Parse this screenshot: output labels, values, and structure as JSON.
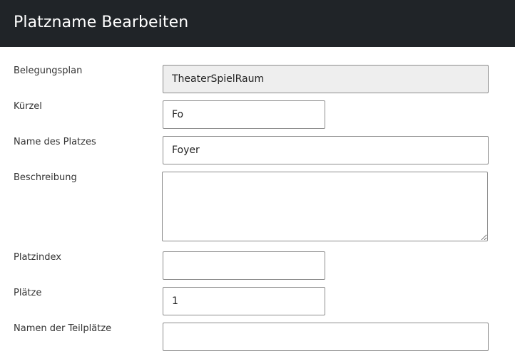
{
  "header": {
    "title": "Platzname Bearbeiten"
  },
  "form": {
    "belegungsplan": {
      "label": "Belegungsplan",
      "value": "TheaterSpielRaum"
    },
    "kuerzel": {
      "label": "Kürzel",
      "value": "Fo"
    },
    "name": {
      "label": "Name des Platzes",
      "value": "Foyer"
    },
    "beschreibung": {
      "label": "Beschreibung",
      "value": ""
    },
    "platzindex": {
      "label": "Platzindex",
      "value": ""
    },
    "plaetze": {
      "label": "Plätze",
      "value": "1"
    },
    "teilplaetze": {
      "label": "Namen der Teilplätze",
      "value": ""
    }
  },
  "colors": {
    "header_bg": "#202428",
    "readonly_bg": "#eeeeee",
    "border": "#8c8c8c"
  }
}
